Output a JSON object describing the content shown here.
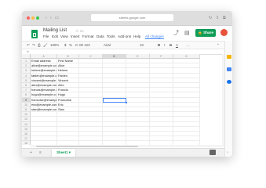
{
  "browser": {
    "url": "sheets.google.com"
  },
  "doc": {
    "title": "Mailing List",
    "menu": [
      "File",
      "Edit",
      "View",
      "Insert",
      "Format",
      "Data",
      "Tools",
      "Add-ons",
      "Help"
    ],
    "all_changes": "All changes",
    "share_label": "Share"
  },
  "toolbar": {
    "zoom": "100%",
    "currency": "$",
    "percent": "%",
    "decimals": ".0  .00  123",
    "font": "Arial",
    "font_size": "10",
    "bold": "B",
    "italic": "I",
    "strike": "S",
    "text_color": "A",
    "more": "..."
  },
  "formula_bar": {
    "fx": "fx"
  },
  "grid": {
    "columns": [
      "A",
      "B",
      "C",
      "D",
      "E",
      "F",
      "G"
    ],
    "row_numbers": [
      "1",
      "2",
      "3",
      "4",
      "5",
      "6",
      "7",
      "8",
      "9",
      "10",
      "11",
      "12",
      "13",
      "14",
      "15",
      "16",
      "17",
      "18"
    ],
    "rows": [
      [
        "Email address",
        "First Name"
      ],
      [
        "alice@example.com",
        "Alice"
      ],
      [
        "helene@example.com",
        "Helene"
      ],
      [
        "fabien@example.com",
        "Fabien"
      ],
      [
        "vincent@example.com",
        "Vincent"
      ],
      [
        "alex@example.com",
        "Alex"
      ],
      [
        "francis@example.com",
        "Francis"
      ],
      [
        "hugo@example.com",
        "Hugo"
      ],
      [
        "francoise@example.com",
        "Francoise"
      ],
      [
        "eric@example.com",
        "Eric"
      ],
      [
        "stan@example.com",
        "Stan"
      ]
    ]
  },
  "sheets": {
    "add": "+",
    "list": "≡",
    "active_tab": "Sheet1"
  },
  "colors": {
    "brand_green": "#0f9d58",
    "selection_blue": "#4285f4",
    "avatar": "#e8513a"
  }
}
